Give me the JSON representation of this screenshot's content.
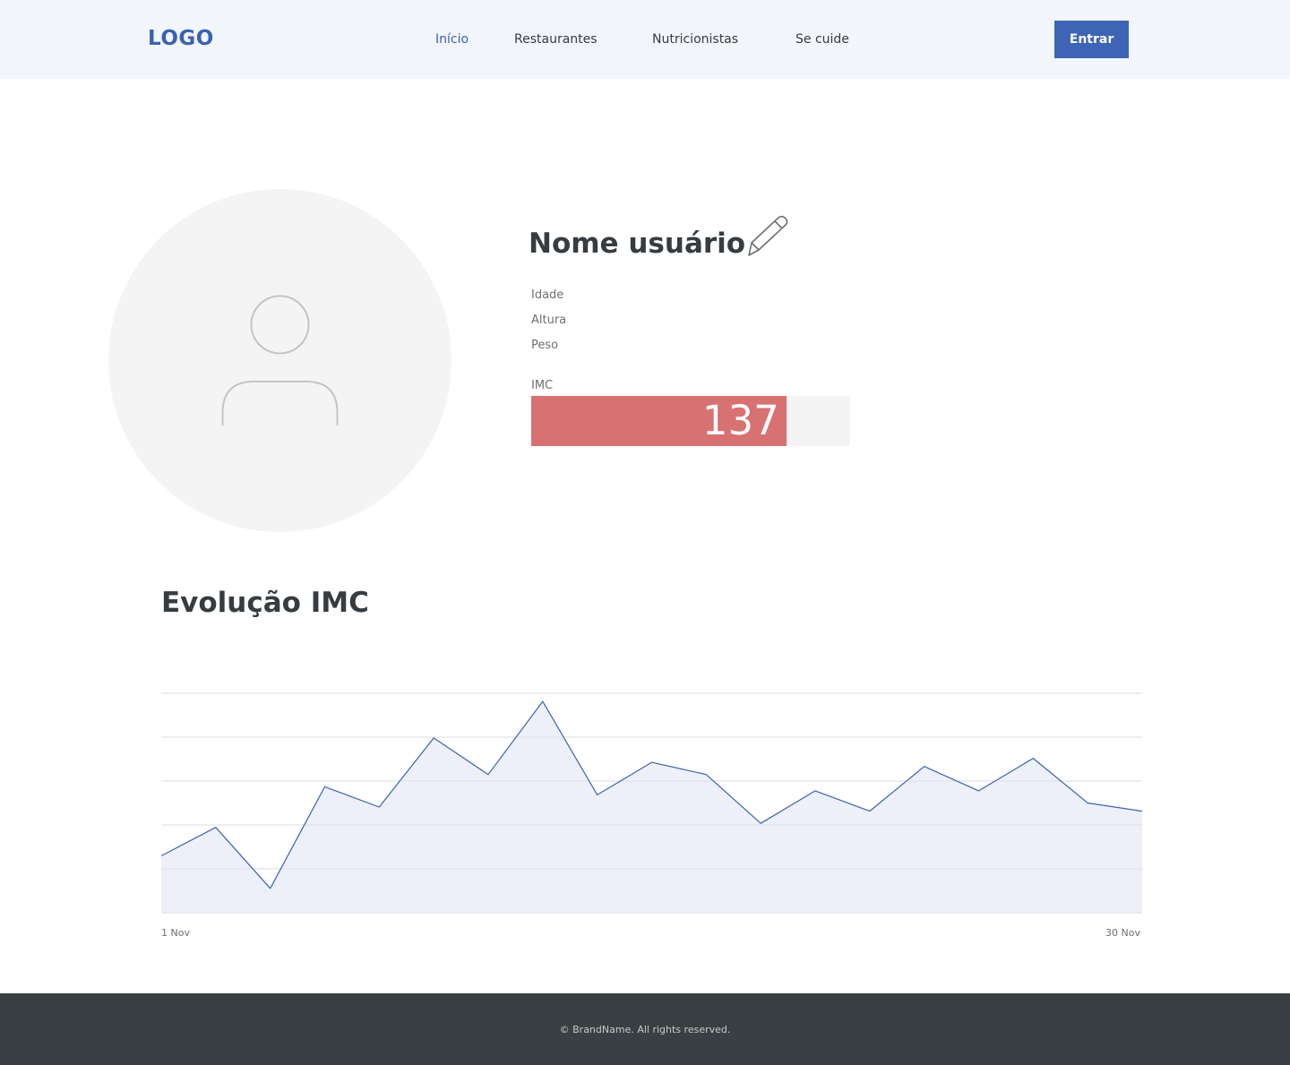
{
  "header": {
    "logo": "LOGO",
    "nav": [
      {
        "label": "Início",
        "active": true
      },
      {
        "label": "Restaurantes",
        "active": false
      },
      {
        "label": "Nutricionistas",
        "active": false
      },
      {
        "label": "Se cuide",
        "active": false
      }
    ],
    "login_button": "Entrar"
  },
  "profile": {
    "avatar_icon": "user-icon",
    "name": "Nome usuário",
    "edit_icon": "pencil-icon",
    "fields": [
      {
        "label": "Idade"
      },
      {
        "label": "Altura"
      },
      {
        "label": "Peso"
      }
    ],
    "imc": {
      "label": "IMC",
      "value": "137",
      "bar_fraction": 0.8,
      "bar_color": "#d87171"
    }
  },
  "evolution": {
    "title": "Evolução IMC"
  },
  "chart_data": {
    "type": "area",
    "title": "",
    "xlabel": "",
    "ylabel": "",
    "x_tick_labels": [
      "1 Nov",
      "30 Nov"
    ],
    "y_gridlines": 5,
    "grid": true,
    "legend": "none",
    "line_color": "#3a62b1",
    "fill_color": "#eaedf7",
    "series": [
      {
        "values": [
          14,
          21,
          6,
          31,
          26,
          43,
          34,
          52,
          29,
          37,
          34,
          22,
          30,
          25,
          36,
          30,
          38,
          27,
          25
        ]
      }
    ],
    "ylim": [
      0,
      54
    ]
  },
  "footer": {
    "text": "© BrandName. All rights reserved."
  }
}
